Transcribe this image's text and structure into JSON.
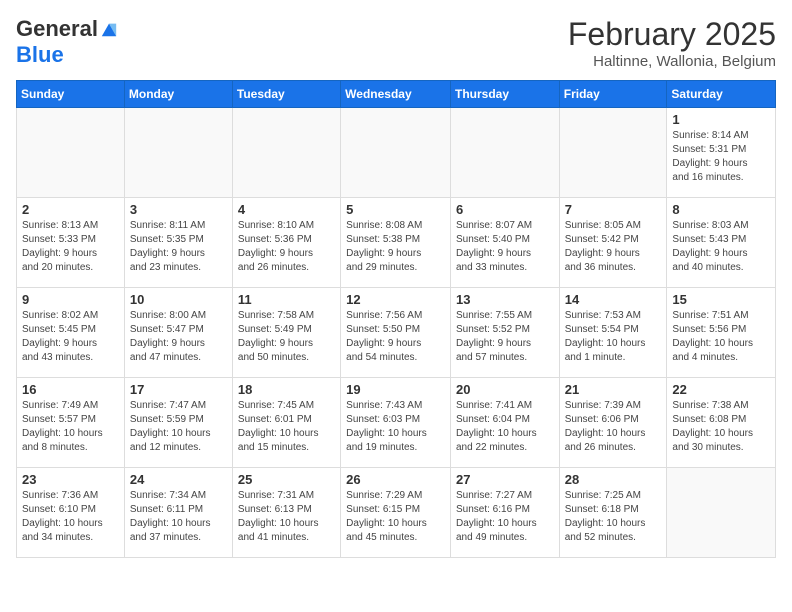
{
  "header": {
    "logo_general": "General",
    "logo_blue": "Blue",
    "month_title": "February 2025",
    "location": "Haltinne, Wallonia, Belgium"
  },
  "weekdays": [
    "Sunday",
    "Monday",
    "Tuesday",
    "Wednesday",
    "Thursday",
    "Friday",
    "Saturday"
  ],
  "weeks": [
    [
      {
        "day": "",
        "info": ""
      },
      {
        "day": "",
        "info": ""
      },
      {
        "day": "",
        "info": ""
      },
      {
        "day": "",
        "info": ""
      },
      {
        "day": "",
        "info": ""
      },
      {
        "day": "",
        "info": ""
      },
      {
        "day": "1",
        "info": "Sunrise: 8:14 AM\nSunset: 5:31 PM\nDaylight: 9 hours\nand 16 minutes."
      }
    ],
    [
      {
        "day": "2",
        "info": "Sunrise: 8:13 AM\nSunset: 5:33 PM\nDaylight: 9 hours\nand 20 minutes."
      },
      {
        "day": "3",
        "info": "Sunrise: 8:11 AM\nSunset: 5:35 PM\nDaylight: 9 hours\nand 23 minutes."
      },
      {
        "day": "4",
        "info": "Sunrise: 8:10 AM\nSunset: 5:36 PM\nDaylight: 9 hours\nand 26 minutes."
      },
      {
        "day": "5",
        "info": "Sunrise: 8:08 AM\nSunset: 5:38 PM\nDaylight: 9 hours\nand 29 minutes."
      },
      {
        "day": "6",
        "info": "Sunrise: 8:07 AM\nSunset: 5:40 PM\nDaylight: 9 hours\nand 33 minutes."
      },
      {
        "day": "7",
        "info": "Sunrise: 8:05 AM\nSunset: 5:42 PM\nDaylight: 9 hours\nand 36 minutes."
      },
      {
        "day": "8",
        "info": "Sunrise: 8:03 AM\nSunset: 5:43 PM\nDaylight: 9 hours\nand 40 minutes."
      }
    ],
    [
      {
        "day": "9",
        "info": "Sunrise: 8:02 AM\nSunset: 5:45 PM\nDaylight: 9 hours\nand 43 minutes."
      },
      {
        "day": "10",
        "info": "Sunrise: 8:00 AM\nSunset: 5:47 PM\nDaylight: 9 hours\nand 47 minutes."
      },
      {
        "day": "11",
        "info": "Sunrise: 7:58 AM\nSunset: 5:49 PM\nDaylight: 9 hours\nand 50 minutes."
      },
      {
        "day": "12",
        "info": "Sunrise: 7:56 AM\nSunset: 5:50 PM\nDaylight: 9 hours\nand 54 minutes."
      },
      {
        "day": "13",
        "info": "Sunrise: 7:55 AM\nSunset: 5:52 PM\nDaylight: 9 hours\nand 57 minutes."
      },
      {
        "day": "14",
        "info": "Sunrise: 7:53 AM\nSunset: 5:54 PM\nDaylight: 10 hours\nand 1 minute."
      },
      {
        "day": "15",
        "info": "Sunrise: 7:51 AM\nSunset: 5:56 PM\nDaylight: 10 hours\nand 4 minutes."
      }
    ],
    [
      {
        "day": "16",
        "info": "Sunrise: 7:49 AM\nSunset: 5:57 PM\nDaylight: 10 hours\nand 8 minutes."
      },
      {
        "day": "17",
        "info": "Sunrise: 7:47 AM\nSunset: 5:59 PM\nDaylight: 10 hours\nand 12 minutes."
      },
      {
        "day": "18",
        "info": "Sunrise: 7:45 AM\nSunset: 6:01 PM\nDaylight: 10 hours\nand 15 minutes."
      },
      {
        "day": "19",
        "info": "Sunrise: 7:43 AM\nSunset: 6:03 PM\nDaylight: 10 hours\nand 19 minutes."
      },
      {
        "day": "20",
        "info": "Sunrise: 7:41 AM\nSunset: 6:04 PM\nDaylight: 10 hours\nand 22 minutes."
      },
      {
        "day": "21",
        "info": "Sunrise: 7:39 AM\nSunset: 6:06 PM\nDaylight: 10 hours\nand 26 minutes."
      },
      {
        "day": "22",
        "info": "Sunrise: 7:38 AM\nSunset: 6:08 PM\nDaylight: 10 hours\nand 30 minutes."
      }
    ],
    [
      {
        "day": "23",
        "info": "Sunrise: 7:36 AM\nSunset: 6:10 PM\nDaylight: 10 hours\nand 34 minutes."
      },
      {
        "day": "24",
        "info": "Sunrise: 7:34 AM\nSunset: 6:11 PM\nDaylight: 10 hours\nand 37 minutes."
      },
      {
        "day": "25",
        "info": "Sunrise: 7:31 AM\nSunset: 6:13 PM\nDaylight: 10 hours\nand 41 minutes."
      },
      {
        "day": "26",
        "info": "Sunrise: 7:29 AM\nSunset: 6:15 PM\nDaylight: 10 hours\nand 45 minutes."
      },
      {
        "day": "27",
        "info": "Sunrise: 7:27 AM\nSunset: 6:16 PM\nDaylight: 10 hours\nand 49 minutes."
      },
      {
        "day": "28",
        "info": "Sunrise: 7:25 AM\nSunset: 6:18 PM\nDaylight: 10 hours\nand 52 minutes."
      },
      {
        "day": "",
        "info": ""
      }
    ]
  ]
}
